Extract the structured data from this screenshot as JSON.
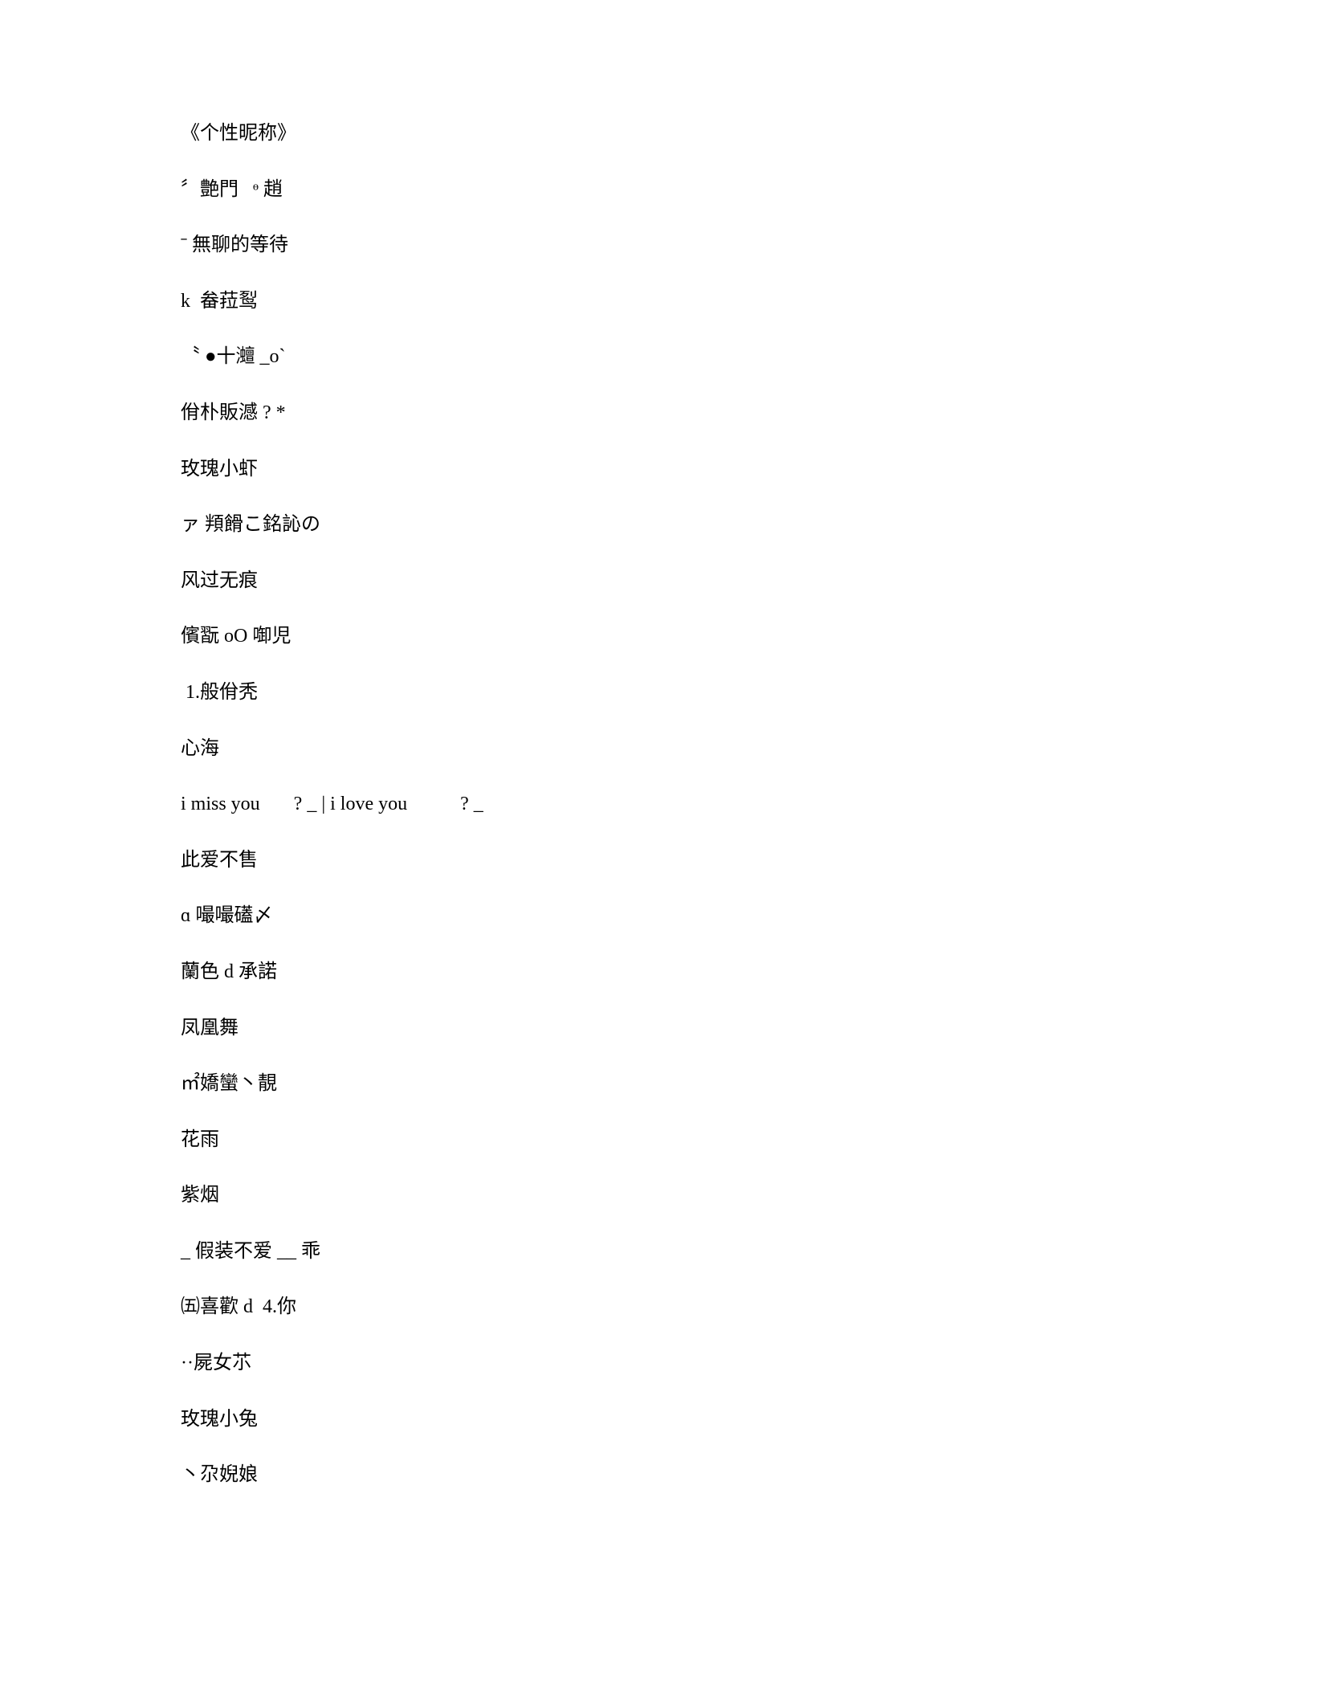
{
  "lines": [
    "《个性昵称》",
    "〞艶門   ᶱ 趙",
    "ˉ 無聊的等待",
    "k  畚菈䴕",
    "〝 ●十灗 _o`",
    "佾朴販澸 ? *",
    "玫瑰小虾",
    "ァ 頖餶こ銘訫の",
    "风过无痕",
    "儐翫 oO 啣児",
    " 1.般佾秃",
    "心海",
    "i miss you       ? _ | i love you           ? _",
    "此爱不售",
    "ɑ 嘬嘬礚〆",
    "蘭色 d 承諾",
    "凤凰舞",
    "㎡嬌蠻丶靚",
    "花雨",
    "紫烟",
    "_ 假装不爱 __ 乖",
    "㈤喜歡 d  4.你",
    "··屍女䒕",
    "玫瑰小兔",
    "丶尕婗娘"
  ]
}
